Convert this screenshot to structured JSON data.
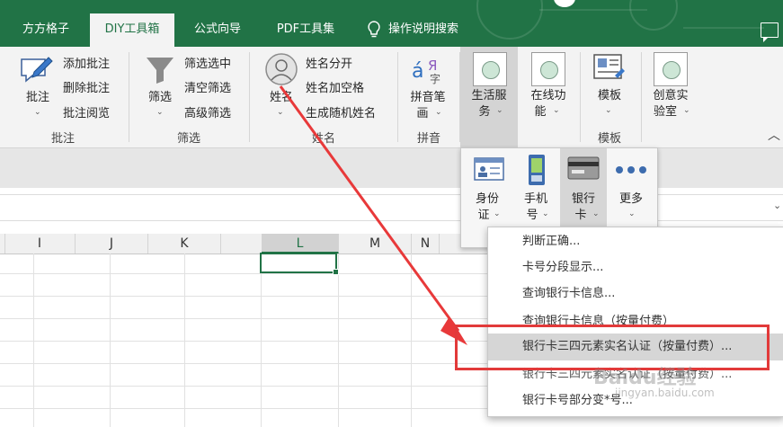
{
  "tabs": [
    {
      "label": "方方格子",
      "active": false
    },
    {
      "label": "DIY工具箱",
      "active": true
    },
    {
      "label": "公式向导",
      "active": false
    },
    {
      "label": "PDF工具集",
      "active": false
    },
    {
      "label": "操作说明搜索",
      "active": false
    }
  ],
  "ribbon": {
    "comment_group": {
      "big_label": "批注",
      "items": [
        "添加批注",
        "删除批注",
        "批注阅览"
      ],
      "group_label": "批注"
    },
    "filter_group": {
      "big_label": "筛选",
      "items": [
        "筛选选中",
        "清空筛选",
        "高级筛选"
      ],
      "group_label": "筛选"
    },
    "name_group": {
      "big_label": "姓名",
      "items": [
        "姓名分开",
        "姓名加空格",
        "生成随机姓名"
      ],
      "group_label": "姓名"
    },
    "pinyin_group": {
      "big_label_1": "拼音笔",
      "big_label_2": "画",
      "group_label": "拼音"
    },
    "life_services": {
      "label_1": "生活服",
      "label_2": "务"
    },
    "online": {
      "label_1": "在线功",
      "label_2": "能"
    },
    "template": {
      "label": "模板",
      "group_label": "模板"
    },
    "creative": {
      "label_1": "创意实",
      "label_2": "验室"
    }
  },
  "subpopup": [
    {
      "label_1": "身份",
      "label_2": "证",
      "icon": "id-card-icon"
    },
    {
      "label_1": "手机",
      "label_2": "号",
      "icon": "mobile-phone-icon"
    },
    {
      "label_1": "银行",
      "label_2": "卡",
      "icon": "bank-card-icon"
    },
    {
      "label_1": "更多",
      "label_2": "",
      "icon": "more-dots-icon"
    }
  ],
  "columns": [
    "I",
    "J",
    "K",
    "L",
    "M",
    "N"
  ],
  "menu_items": [
    {
      "label": "判断正确..."
    },
    {
      "label": "卡号分段显示..."
    },
    {
      "label": "查询银行卡信息..."
    },
    {
      "label": "查询银行卡信息（按量付费）"
    },
    {
      "label": "银行卡三四元素实名认证（按量付费）..."
    },
    {
      "label": "银行卡三四元素实名认证（按量付费）..."
    },
    {
      "label": "银行卡号部分变*号..."
    }
  ],
  "watermark": {
    "brand": "Baidu经验",
    "url": "jingyan.baidu.com"
  },
  "colors": {
    "excel_green": "#217346",
    "highlight_red": "#e23a3a",
    "arrow_red": "#e8393a"
  }
}
